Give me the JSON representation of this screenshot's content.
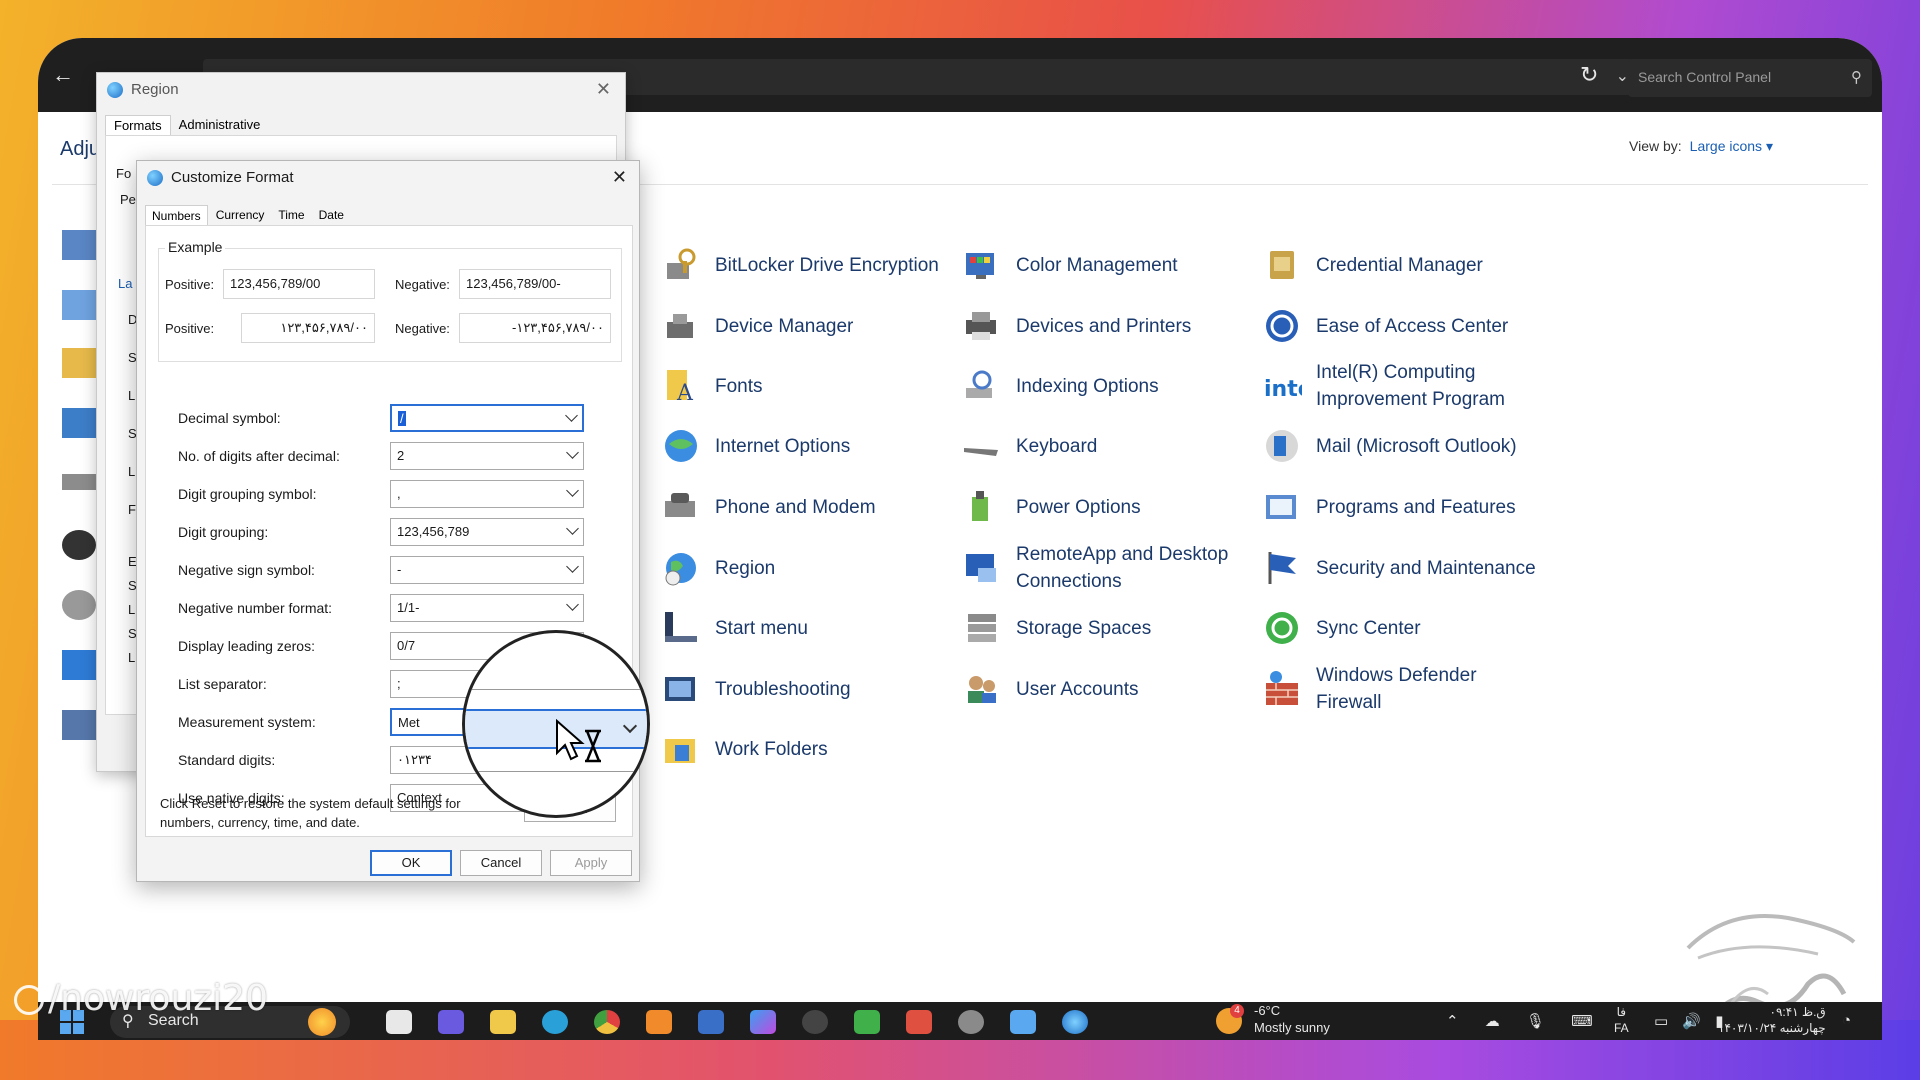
{
  "explorer": {
    "search_placeholder": "Search Control Panel",
    "heading": "Adju",
    "view_by_label": "View by:",
    "view_by_value": "Large icons ▾"
  },
  "control_panel_items": [
    {
      "label": "BitLocker Drive Encryption",
      "icon": "bitlocker-icon"
    },
    {
      "label": "Color Management",
      "icon": "color-management-icon"
    },
    {
      "label": "Credential Manager",
      "icon": "credential-manager-icon"
    },
    {
      "label": "Device Manager",
      "icon": "device-manager-icon"
    },
    {
      "label": "Devices and Printers",
      "icon": "devices-printers-icon"
    },
    {
      "label": "Ease of Access Center",
      "icon": "ease-of-access-icon"
    },
    {
      "label": "Fonts",
      "icon": "fonts-icon"
    },
    {
      "label": "Indexing Options",
      "icon": "indexing-options-icon"
    },
    {
      "label": "Intel(R) Computing Improvement Program",
      "icon": "intel-icon"
    },
    {
      "label": "Internet Options",
      "icon": "internet-options-icon"
    },
    {
      "label": "Keyboard",
      "icon": "keyboard-icon"
    },
    {
      "label": "Mail (Microsoft Outlook)",
      "icon": "mail-icon"
    },
    {
      "label": "Phone and Modem",
      "icon": "phone-modem-icon"
    },
    {
      "label": "Power Options",
      "icon": "power-options-icon"
    },
    {
      "label": "Programs and Features",
      "icon": "programs-features-icon"
    },
    {
      "label": "Region",
      "icon": "region-icon"
    },
    {
      "label": "RemoteApp and Desktop Connections",
      "icon": "remoteapp-icon"
    },
    {
      "label": "Security and Maintenance",
      "icon": "security-maintenance-icon"
    },
    {
      "label": "Start menu",
      "icon": "start-menu-icon"
    },
    {
      "label": "Storage Spaces",
      "icon": "storage-spaces-icon"
    },
    {
      "label": "Sync Center",
      "icon": "sync-center-icon"
    },
    {
      "label": "Troubleshooting",
      "icon": "troubleshooting-icon"
    },
    {
      "label": "User Accounts",
      "icon": "user-accounts-icon"
    },
    {
      "label": "Windows Defender Firewall",
      "icon": "firewall-icon"
    },
    {
      "label": "Work Folders",
      "icon": "work-folders-icon"
    }
  ],
  "region_dialog": {
    "title": "Region",
    "tabs": [
      "Formats",
      "Administrative"
    ],
    "fragments": [
      "Fo",
      "Pe",
      "La",
      "D",
      "S",
      "L",
      "S",
      "L",
      "F",
      "E",
      "S",
      "L",
      "S",
      "L"
    ]
  },
  "customize_dialog": {
    "title": "Customize Format",
    "tabs": [
      "Numbers",
      "Currency",
      "Time",
      "Date"
    ],
    "example_legend": "Example",
    "positive_label": "Positive:",
    "negative_label": "Negative:",
    "positive_1": "123,456,789/00",
    "negative_1": "123,456,789/00-",
    "positive_2": "۱۲۳,۴۵۶,۷۸۹/۰۰",
    "negative_2": "-۱۲۳,۴۵۶,۷۸۹/۰۰",
    "rows": [
      {
        "label": "Decimal symbol:",
        "value": "/"
      },
      {
        "label": "No. of digits after decimal:",
        "value": "2"
      },
      {
        "label": "Digit grouping symbol:",
        "value": ","
      },
      {
        "label": "Digit grouping:",
        "value": "123,456,789"
      },
      {
        "label": "Negative sign symbol:",
        "value": "-"
      },
      {
        "label": "Negative number format:",
        "value": "1/1-"
      },
      {
        "label": "Display leading zeros:",
        "value": "0/7"
      },
      {
        "label": "List separator:",
        "value": ";"
      },
      {
        "label": "Measurement system:",
        "value": "Met"
      },
      {
        "label": "Standard digits:",
        "value": "۰۱۲۳۴"
      },
      {
        "label": "Use native digits:",
        "value": "Context"
      }
    ],
    "reset_text": "Click Reset to restore the system default settings for numbers, currency, time, and date.",
    "reset_button": "Reset",
    "ok_button": "OK",
    "cancel_button": "Cancel",
    "apply_button": "Apply"
  },
  "taskbar": {
    "search": "Search",
    "weather_temp": "-6°C",
    "weather_desc": "Mostly sunny",
    "weather_badge": "4",
    "lang_1": "فا",
    "lang_2": "FA",
    "time": "۰۹:۴۱ ق.ظ",
    "date": "۱۴۰۳/۱۰/۲۴ چهارشنبه"
  },
  "watermark": "/nowrouzi20",
  "colors": {
    "link_blue": "#1b3a6b",
    "accent": "#2a6fd6",
    "taskbar": "#1c1c1c"
  }
}
